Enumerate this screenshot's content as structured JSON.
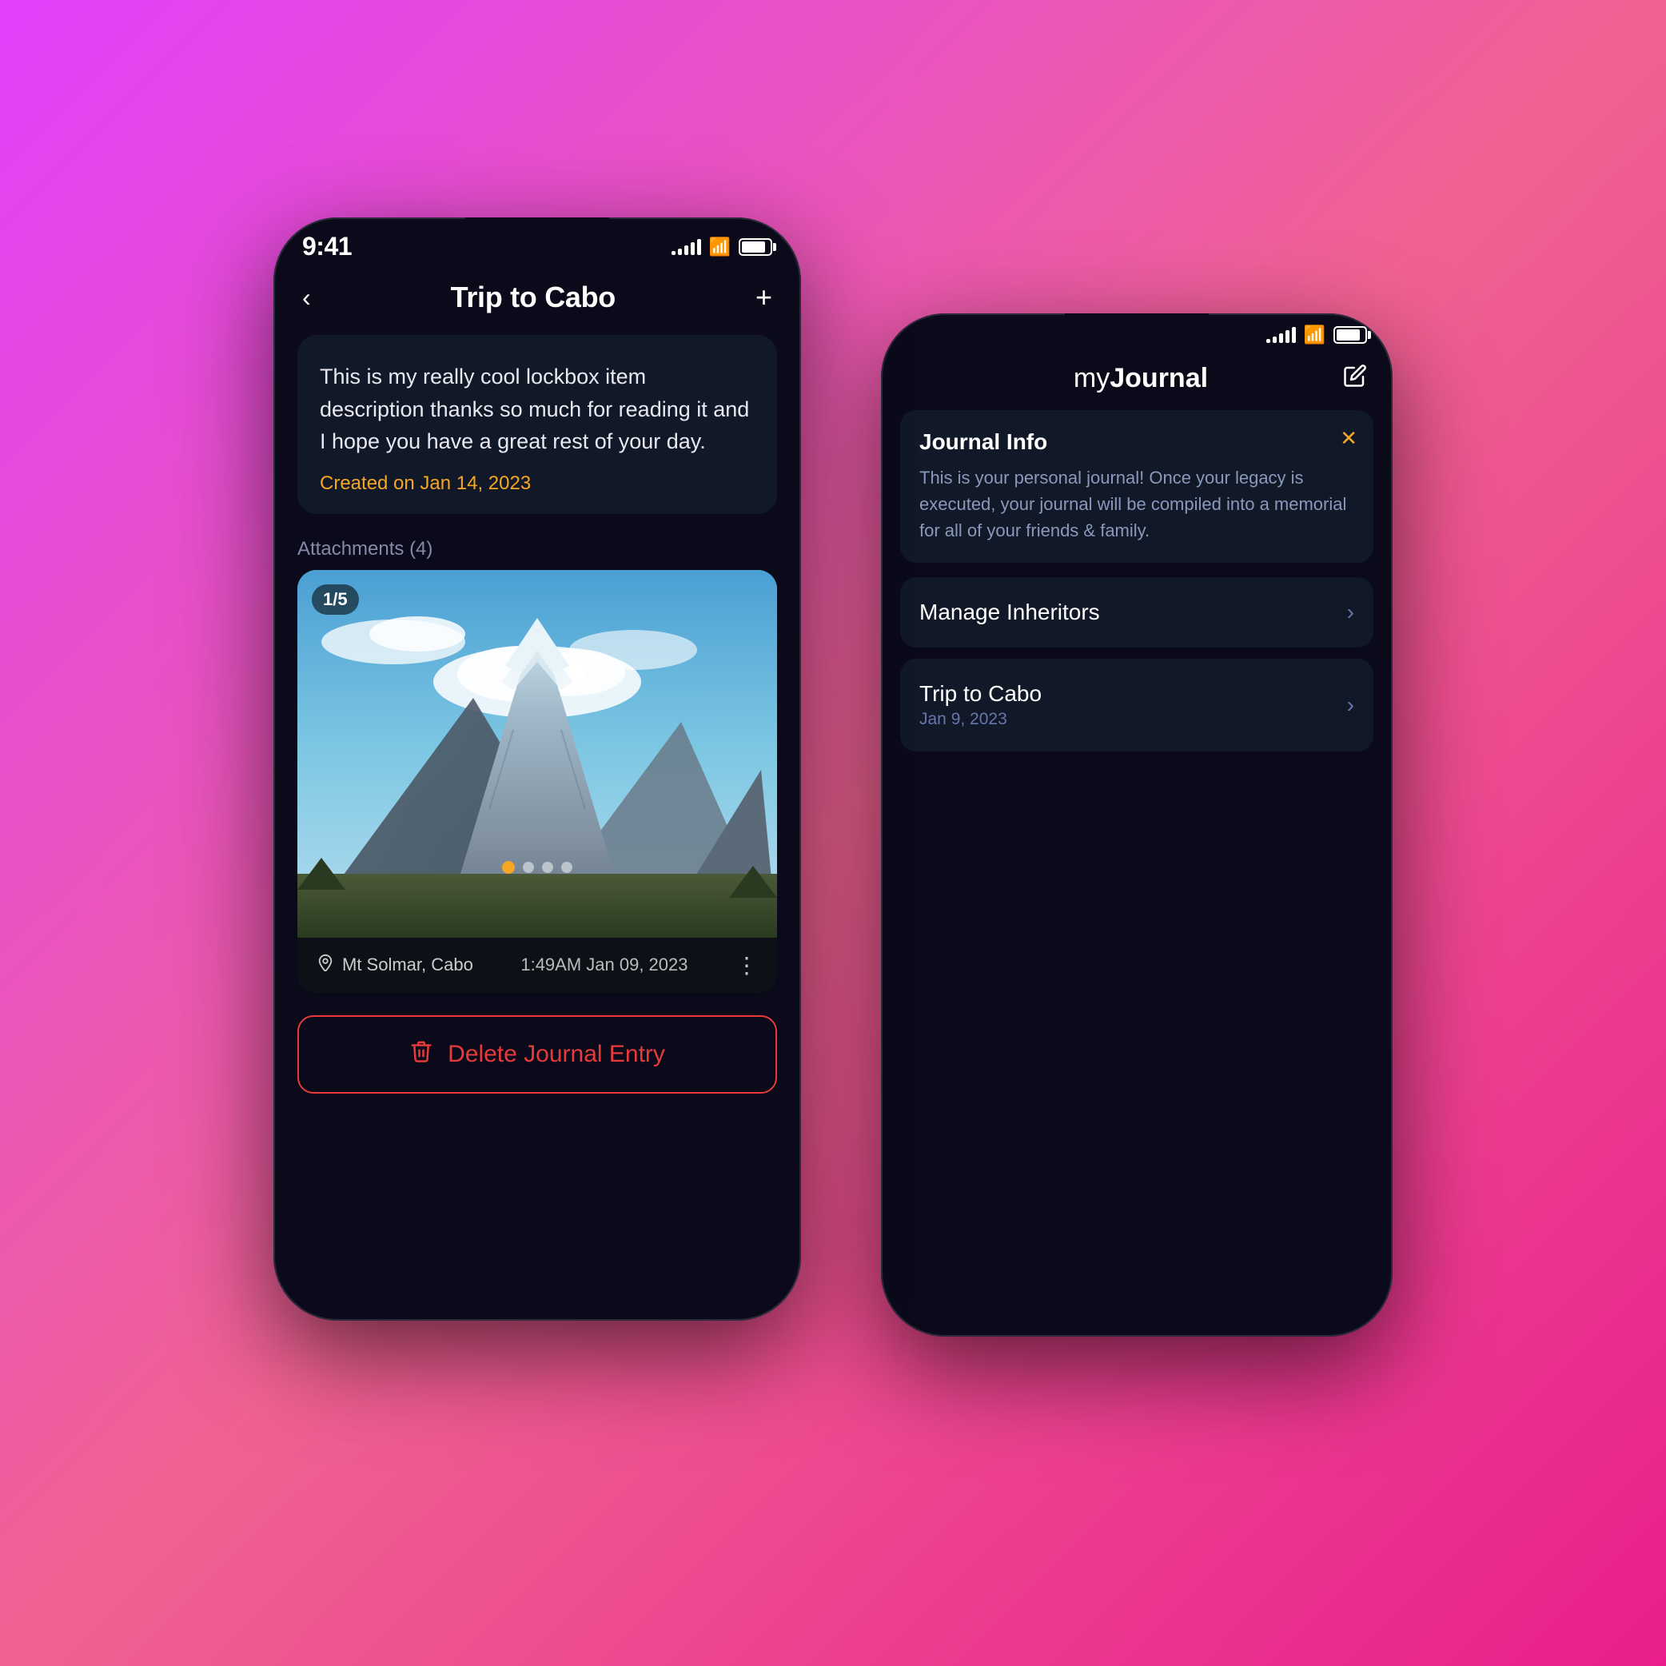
{
  "background": "#e040fb",
  "phone_front": {
    "status": {
      "time": "9:41",
      "signal_bars": [
        4,
        7,
        10,
        13,
        16
      ],
      "battery_percent": 85
    },
    "nav": {
      "back_label": "‹",
      "title": "Trip to Cabo",
      "add_label": "+"
    },
    "description": {
      "text": "This is my really cool lockbox item description thanks so much for reading it and I hope you have a great rest of your day.",
      "created": "Created on Jan 14, 2023"
    },
    "attachments": {
      "label": "Attachments (4)",
      "counter": "1/5",
      "location": "Mt Solmar, Cabo",
      "timestamp": "1:49AM  Jan 09, 2023",
      "dots": [
        "active",
        "inactive",
        "inactive",
        "inactive"
      ]
    },
    "delete_button": {
      "icon": "🗑",
      "label": "Delete Journal Entry"
    }
  },
  "phone_back": {
    "status": {
      "signal_bars": [
        4,
        7,
        10,
        13,
        16
      ],
      "battery_percent": 85
    },
    "nav": {
      "title_my": "my",
      "title_journal": "Journal",
      "edit_icon": "✏"
    },
    "journal_info": {
      "title": "Journal Info",
      "close_icon": "✕",
      "text": "This is your personal journal! Once your legacy is executed, your journal will be compiled into a memorial for all of your friends & family."
    },
    "list_items": [
      {
        "title": "Manage Inheritors",
        "subtitle": null,
        "chevron": "›"
      },
      {
        "title": "Trip to Cabo",
        "subtitle": "Jan 9, 2023",
        "chevron": "›"
      }
    ]
  }
}
